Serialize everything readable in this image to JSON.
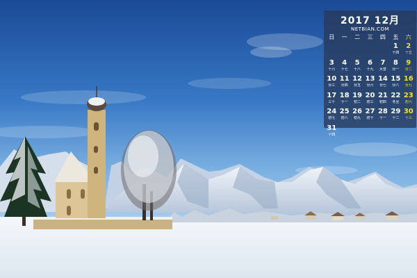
{
  "calendar": {
    "year_month": "2017 12月",
    "site": "NETBIAN.COM",
    "weekday_headers": [
      "日",
      "一",
      "二",
      "三",
      "四",
      "五",
      "六"
    ],
    "lead_blanks": 5,
    "days": [
      {
        "d": "1",
        "l": "十四"
      },
      {
        "d": "2",
        "l": "十五"
      },
      {
        "d": "3",
        "l": "十六"
      },
      {
        "d": "4",
        "l": "十七"
      },
      {
        "d": "5",
        "l": "十八"
      },
      {
        "d": "6",
        "l": "十九"
      },
      {
        "d": "7",
        "l": "大雪"
      },
      {
        "d": "8",
        "l": "廿一"
      },
      {
        "d": "9",
        "l": "廿二"
      },
      {
        "d": "10",
        "l": "廿三"
      },
      {
        "d": "11",
        "l": "廿四"
      },
      {
        "d": "12",
        "l": "廿五"
      },
      {
        "d": "13",
        "l": "廿六"
      },
      {
        "d": "14",
        "l": "廿七"
      },
      {
        "d": "15",
        "l": "廿八"
      },
      {
        "d": "16",
        "l": "廿九"
      },
      {
        "d": "17",
        "l": "三十"
      },
      {
        "d": "18",
        "l": "十一"
      },
      {
        "d": "19",
        "l": "初二"
      },
      {
        "d": "20",
        "l": "初三"
      },
      {
        "d": "21",
        "l": "初四"
      },
      {
        "d": "22",
        "l": "冬至"
      },
      {
        "d": "23",
        "l": "初六"
      },
      {
        "d": "24",
        "l": "初七"
      },
      {
        "d": "25",
        "l": "初八"
      },
      {
        "d": "26",
        "l": "初九"
      },
      {
        "d": "27",
        "l": "初十"
      },
      {
        "d": "28",
        "l": "十一"
      },
      {
        "d": "29",
        "l": "十二"
      },
      {
        "d": "30",
        "l": "十三"
      },
      {
        "d": "31",
        "l": "十四"
      }
    ],
    "colors": {
      "text": "#ffffff",
      "saturday": "#f2e02a",
      "panel": "#283a5a"
    }
  },
  "scene": {
    "colors": {
      "sky_top": "#1d4f9a",
      "sky_horizon": "#9cc3ea",
      "snow": "#eef3f8",
      "mountain": "#c9d6e6",
      "church_wall": "#d8c290",
      "tower_roof": "#5b4a3e"
    }
  }
}
